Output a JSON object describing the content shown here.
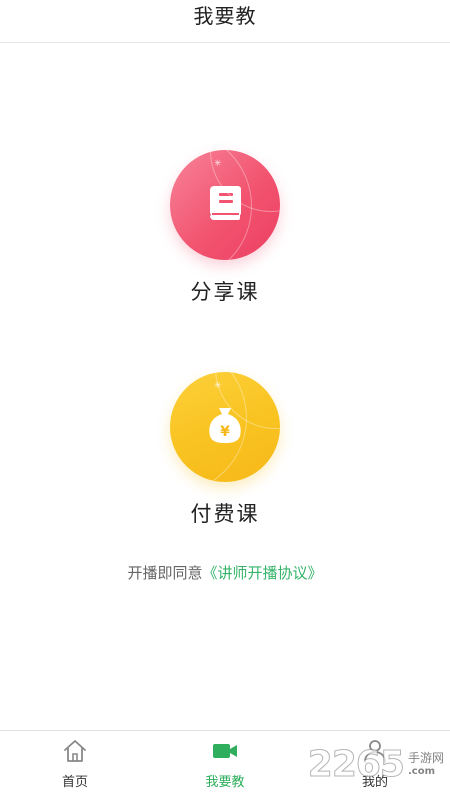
{
  "header": {
    "title": "我要教"
  },
  "options": [
    {
      "label": "分享课",
      "icon": "book-icon",
      "color": "#f2546f"
    },
    {
      "label": "付费课",
      "icon": "money-bag-icon",
      "color": "#f9c422"
    }
  ],
  "agreement": {
    "prefix": "开播即同意",
    "link": "《讲师开播协议》",
    "link_color": "#35b46a"
  },
  "tabbar": {
    "active_color": "#2fae5d",
    "items": [
      {
        "label": "首页",
        "icon": "home-icon"
      },
      {
        "label": "我要教",
        "icon": "video-camera-icon"
      },
      {
        "label": "我的",
        "icon": "user-icon"
      }
    ]
  },
  "watermark": {
    "number": "2265",
    "name": "手游网",
    "domain": ".com"
  }
}
